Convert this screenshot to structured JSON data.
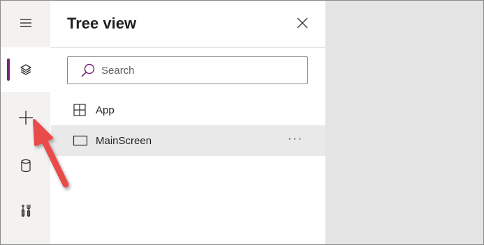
{
  "rail": {
    "items": [
      {
        "name": "menu",
        "icon": "hamburger-menu-icon"
      },
      {
        "name": "tree-view",
        "icon": "layers-icon",
        "active": true
      },
      {
        "name": "insert",
        "icon": "plus-icon"
      },
      {
        "name": "data",
        "icon": "database-icon"
      },
      {
        "name": "advanced-tools",
        "icon": "tools-icon"
      }
    ],
    "accent": "#742774"
  },
  "pane": {
    "title": "Tree view",
    "close_icon": "close-icon",
    "search": {
      "placeholder": "Search",
      "value": ""
    },
    "items": [
      {
        "label": "App",
        "icon": "app-grid-icon",
        "selected": false
      },
      {
        "label": "MainScreen",
        "icon": "screen-icon",
        "selected": true,
        "more": "···"
      }
    ]
  },
  "annotation": {
    "type": "arrow",
    "color": "#e94c4c",
    "points_to": "insert"
  }
}
